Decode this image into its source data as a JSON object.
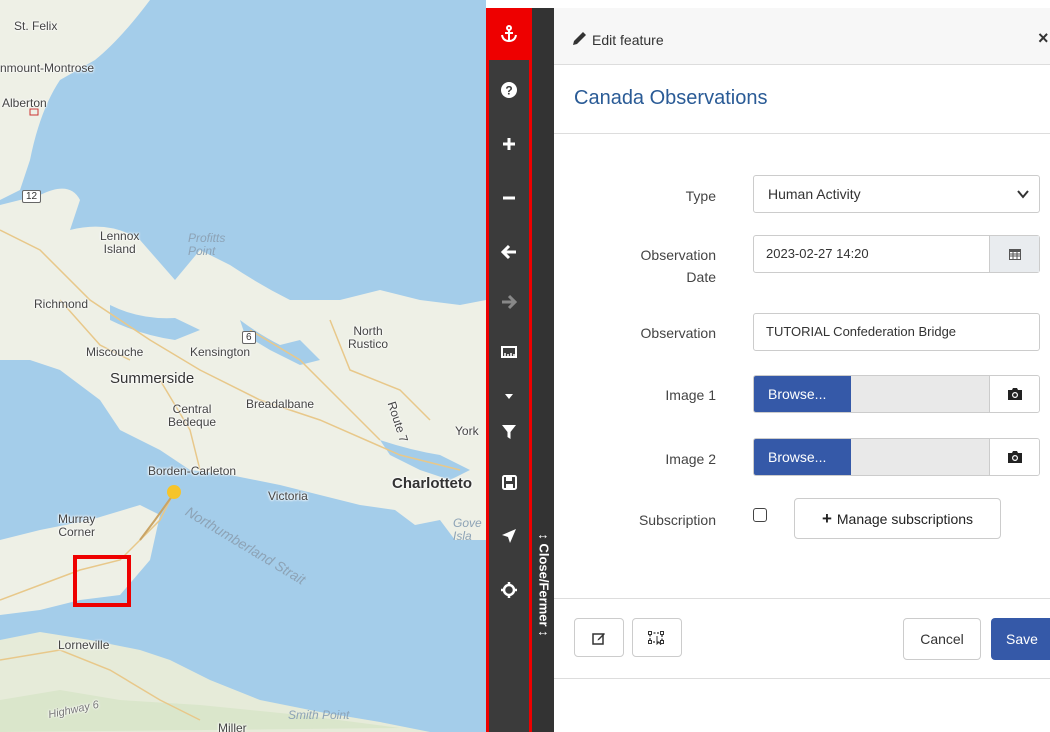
{
  "map": {
    "labels": {
      "st_felix": "St. Felix",
      "montrose": "nmount-Montrose",
      "alberton": "Alberton",
      "lennox": "Lennox\nIsland",
      "profitts": "Profitts\nPoint",
      "richmond": "Richmond",
      "north_rustico": "North\nRustico",
      "miscouche": "Miscouche",
      "kensington": "Kensington",
      "summerside": "Summerside",
      "breadalbane": "Breadalbane",
      "central_bedeque": "Central\nBedeque",
      "route": "Route 7",
      "york": "York",
      "borden": "Borden-Carleton",
      "charlottetown": "Charlotteto",
      "victoria": "Victoria",
      "murray": "Murray\nCorner",
      "strait": "Northumberland Strait",
      "gove": "Gove\nIsla",
      "lorneville": "Lorneville",
      "highway6": "Highway 6",
      "smith_point": "Smith Point",
      "miller": "Miller"
    },
    "shields": {
      "s12": "12",
      "s6": "6"
    }
  },
  "toolbar": {
    "buttons": [
      "anchor-icon",
      "help-icon",
      "zoom-in-icon",
      "zoom-out-icon",
      "back-arrow-icon",
      "forward-arrow-icon",
      "measure-icon",
      "caret-down-icon",
      "filter-icon",
      "save-icon",
      "locate-arrow-icon",
      "crosshair-icon"
    ],
    "close_label": "↕ Close/Fermer ↕"
  },
  "panel": {
    "header_title": "Edit feature",
    "close_symbol": "×",
    "form_title": "Canada Observations",
    "fields": {
      "type_label": "Type",
      "type_value": "Human Activity",
      "date_label": "Observation\nDate",
      "date_value": "2023-02-27 14:20",
      "observation_label": "Observation",
      "observation_value": "TUTORIAL Confederation Bridge",
      "image1_label": "Image 1",
      "image2_label": "Image 2",
      "browse_label": "Browse...",
      "subscription_label": "Subscription",
      "manage_label": "Manage subscriptions",
      "subscription_checked": false
    },
    "footer": {
      "cancel_label": "Cancel",
      "save_label": "Save"
    }
  },
  "colors": {
    "accent": "#3559a8",
    "title": "#2a5b96",
    "toolbar_border": "#e00000"
  }
}
